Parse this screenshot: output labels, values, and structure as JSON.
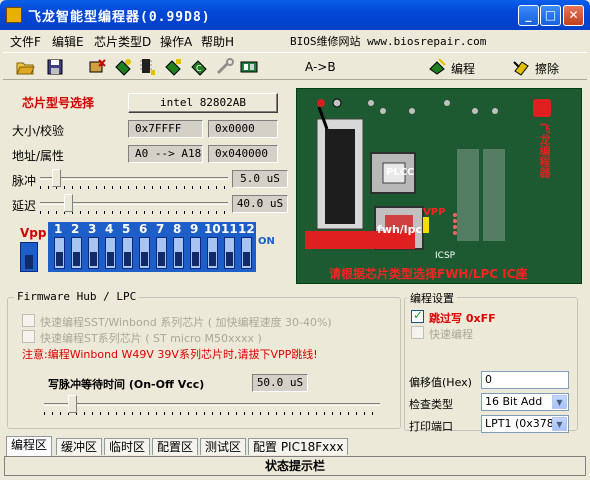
{
  "window": {
    "title": "飞龙智能型编程器(0.99D8)",
    "min": "_",
    "max": "□",
    "close": "✕"
  },
  "menu": {
    "items": [
      "文件F",
      "编辑E",
      "芯片类型D",
      "操作A",
      "帮助H"
    ],
    "site": "BIOS维修网站 www.biosrepair.com"
  },
  "toolbar": {
    "atob": "A->B",
    "program": "编程",
    "erase": "擦除"
  },
  "chip": {
    "select_label": "芯片型号选择",
    "chip_name": "intel 82802AB",
    "size_label": "大小/校验",
    "size_value": "0x7FFFF",
    "checksum_value": "0x0000",
    "addr_label": "地址/属性",
    "addr_value": "A0 --> A18",
    "attr_value": "0x040000",
    "pulse_label": "脉冲",
    "pulse_value": "5.0 uS",
    "delay_label": "延迟",
    "delay_value": "40.0 uS"
  },
  "dip": {
    "vpp_label": "Vpp",
    "on_label": "ON",
    "numbers": [
      "1",
      "2",
      "3",
      "4",
      "5",
      "6",
      "7",
      "8",
      "9",
      "10",
      "11",
      "12"
    ]
  },
  "board": {
    "plcc_label": "PLCC",
    "fwh_label": "fwh/lpc",
    "vpp_label": "VPP",
    "icsp_label": "ICSP",
    "hint": "请根据芯片类型选择FWH/LPC IC座",
    "brand_vertical": "飞龙编程器",
    "colors": {
      "board": "#1d5a32",
      "hint": "#ff2020"
    }
  },
  "fwh": {
    "group_title": "Firmware Hub / LPC",
    "opt1": "快速编程SST/Winbond 系列芯片 ( 加快编程速度 30-40%)",
    "opt2": "快速编程ST系列芯片  ( ST micro M50xxxx )",
    "warning": "注意:编程Winbond W49V 39V系列芯片时,请拔下VPP跳线!",
    "wait_label": "写脉冲等待时间  (On-Off Vcc)",
    "wait_value": "50.0 uS"
  },
  "settings": {
    "group_title": "编程设置",
    "skip_write": "跳过写 0xFF",
    "fast_program": "快速编程",
    "offset_label": "偏移值(Hex)",
    "offset_value": "0",
    "check_label": "检查类型",
    "check_value": "16 Bit Add",
    "port_label": "打印端口",
    "port_value": "LPT1 (0x378)"
  },
  "tabs": [
    "编程区",
    "缓冲区",
    "临时区",
    "配置区",
    "测试区",
    "配置 PIC18Fxxx"
  ],
  "status": "状态提示栏"
}
